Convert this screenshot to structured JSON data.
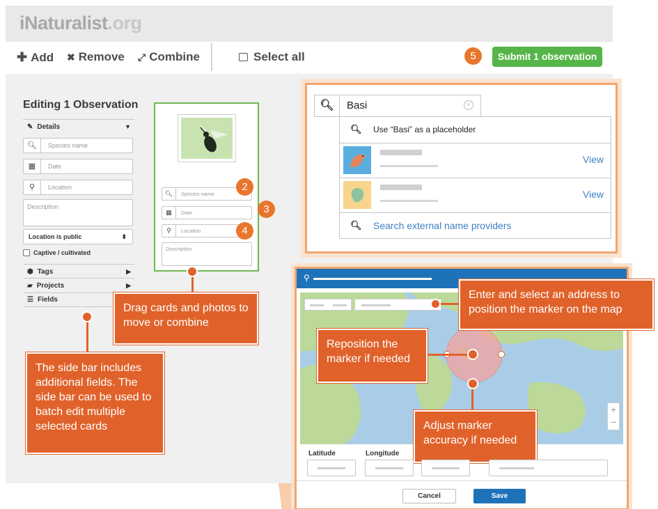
{
  "header": {
    "logo_main": "iNaturalist",
    "logo_tld": ".org"
  },
  "toolbar": {
    "add": "Add",
    "add_icon": "plus-icon",
    "remove": "Remove",
    "remove_icon": "x-icon",
    "combine": "Combine",
    "combine_icon": "combine-icon",
    "select_all": "Select all",
    "step": "5",
    "submit": "Submit 1 observation"
  },
  "sidebar": {
    "title": "Editing 1 Observation",
    "details": "Details",
    "species_placeholder": "Species name",
    "date_placeholder": "Date",
    "location_placeholder": "Location",
    "description_placeholder": "Description",
    "location_select": "Location is public",
    "captive": "Captive / cultivated",
    "tags": "Tags",
    "projects": "Projects",
    "fields": "Fields"
  },
  "card": {
    "species_placeholder": "Species name",
    "date_placeholder": "Date",
    "location_placeholder": "Location",
    "description_placeholder": "Description"
  },
  "steps": {
    "species": "2",
    "date": "3",
    "location": "4"
  },
  "species_search": {
    "query": "Basi",
    "placeholder_option": "Use “Basi” as a placeholder",
    "view_label": "View",
    "external": "Search external name providers"
  },
  "map_editor": {
    "latitude_label": "Latitude",
    "longitude_label": "Longitude",
    "cancel": "Cancel",
    "save": "Save"
  },
  "callouts": {
    "drag": "Drag cards and photos to move or combine",
    "sidebar": "The side bar includes additional fields. The side bar can be used to batch edit multiple selected cards",
    "address": "Enter and select an address to position the marker on the map",
    "reposition": "Reposition the marker if needed",
    "accuracy": "Adjust marker accuracy if needed"
  },
  "colors": {
    "accent_orange": "#e0622a",
    "submit_green": "#56b549",
    "card_border": "#6db84e",
    "link_blue": "#3f7fc1",
    "map_header": "#1e73b8"
  }
}
